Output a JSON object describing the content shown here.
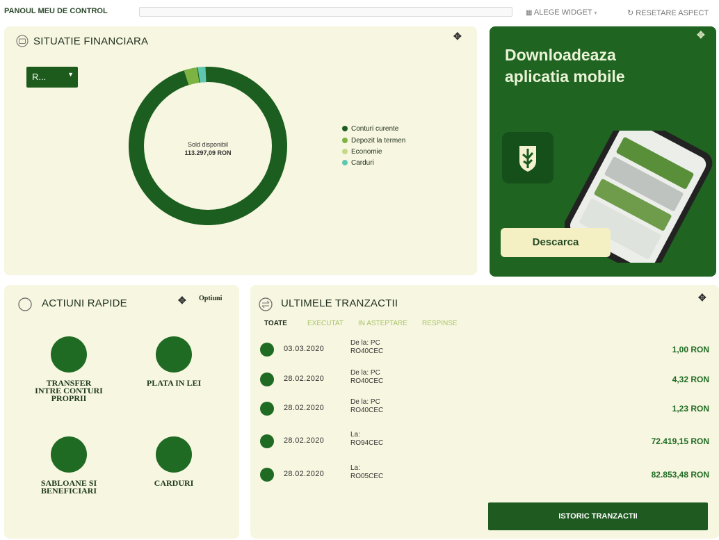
{
  "header": {
    "title": "PANOUL MEU DE CONTROL",
    "choose_widget": "ALEGE WIDGET",
    "reset_layout": "RESETARE ASPECT"
  },
  "financial": {
    "title": "SITUATIE FINANCIARA",
    "select_value": "R...",
    "center_label": "Sold disponibil",
    "center_value": "113.297,09 RON",
    "legend": [
      {
        "label": "Conturi curente",
        "color": "#1b5e20"
      },
      {
        "label": "Depozit la termen",
        "color": "#7cb342"
      },
      {
        "label": "Economie",
        "color": "#c5d98a"
      },
      {
        "label": "Carduri",
        "color": "#5fc6b0"
      }
    ]
  },
  "mobile": {
    "title_line1": "Downloadeaza",
    "title_line2": "aplicatia mobile",
    "button": "Descarca"
  },
  "quick_actions": {
    "title": "ACTIUNI RAPIDE",
    "options": "Optiuni",
    "items": [
      {
        "line1": "TRANSFER",
        "line2": "INTRE CONTURI",
        "line3": "PROPRII"
      },
      {
        "line1": "PLATA IN LEI",
        "line2": "",
        "line3": ""
      },
      {
        "line1": "SABLOANE SI",
        "line2": "BENEFICIARI",
        "line3": ""
      },
      {
        "line1": "CARDURI",
        "line2": "",
        "line3": ""
      }
    ]
  },
  "transactions": {
    "title": "ULTIMELE TRANZACTII",
    "tabs": [
      "TOATE",
      "EXECUTAT",
      "IN ASTEPTARE",
      "RESPINSE"
    ],
    "rows": [
      {
        "date": "03.03.2020",
        "line1": "De la: PC",
        "line2": "RO40CEC",
        "amount": "1,00 RON",
        "direction": "in"
      },
      {
        "date": "28.02.2020",
        "line1": "De la: PC",
        "line2": "RO40CEC",
        "amount": "4,32 RON",
        "direction": "in"
      },
      {
        "date": "28.02.2020",
        "line1": "De la: PC",
        "line2": "RO40CEC",
        "amount": "1,23 RON",
        "direction": "in"
      },
      {
        "date": "28.02.2020",
        "line1": "La:",
        "line2": "RO94CEC",
        "amount": "72.419,15 RON",
        "direction": "out"
      },
      {
        "date": "28.02.2020",
        "line1": "La:",
        "line2": "RO05CEC",
        "amount": "82.853,48 RON",
        "direction": "out"
      }
    ],
    "history_button": "ISTORIC TRANZACTII"
  },
  "colors": {
    "accent": "#1f6b23",
    "panel": "#f7f6e0",
    "mobile_panel": "#1f6420"
  }
}
